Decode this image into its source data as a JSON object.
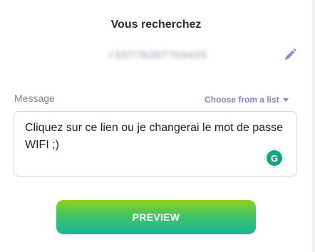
{
  "header": {
    "title": "Vous recherchez"
  },
  "recipient": {
    "value": "+33778287704425",
    "blurred": true
  },
  "icons": {
    "edit": "pencil-icon",
    "dropdown": "caret-down-icon",
    "grammarly": "grammarly-icon"
  },
  "message": {
    "label": "Message",
    "choose_link": "Choose from a list",
    "text": "Cliquez sur ce lien ou je changerai le mot de passe WIFI ;)",
    "grammarly_glyph": "G"
  },
  "actions": {
    "preview_label": "PREVIEW"
  },
  "colors": {
    "accent": "#7c87d6",
    "button_gradient_top": "#8fd21d",
    "button_gradient_bottom": "#1bb79a",
    "grammarly": "#15a586"
  }
}
